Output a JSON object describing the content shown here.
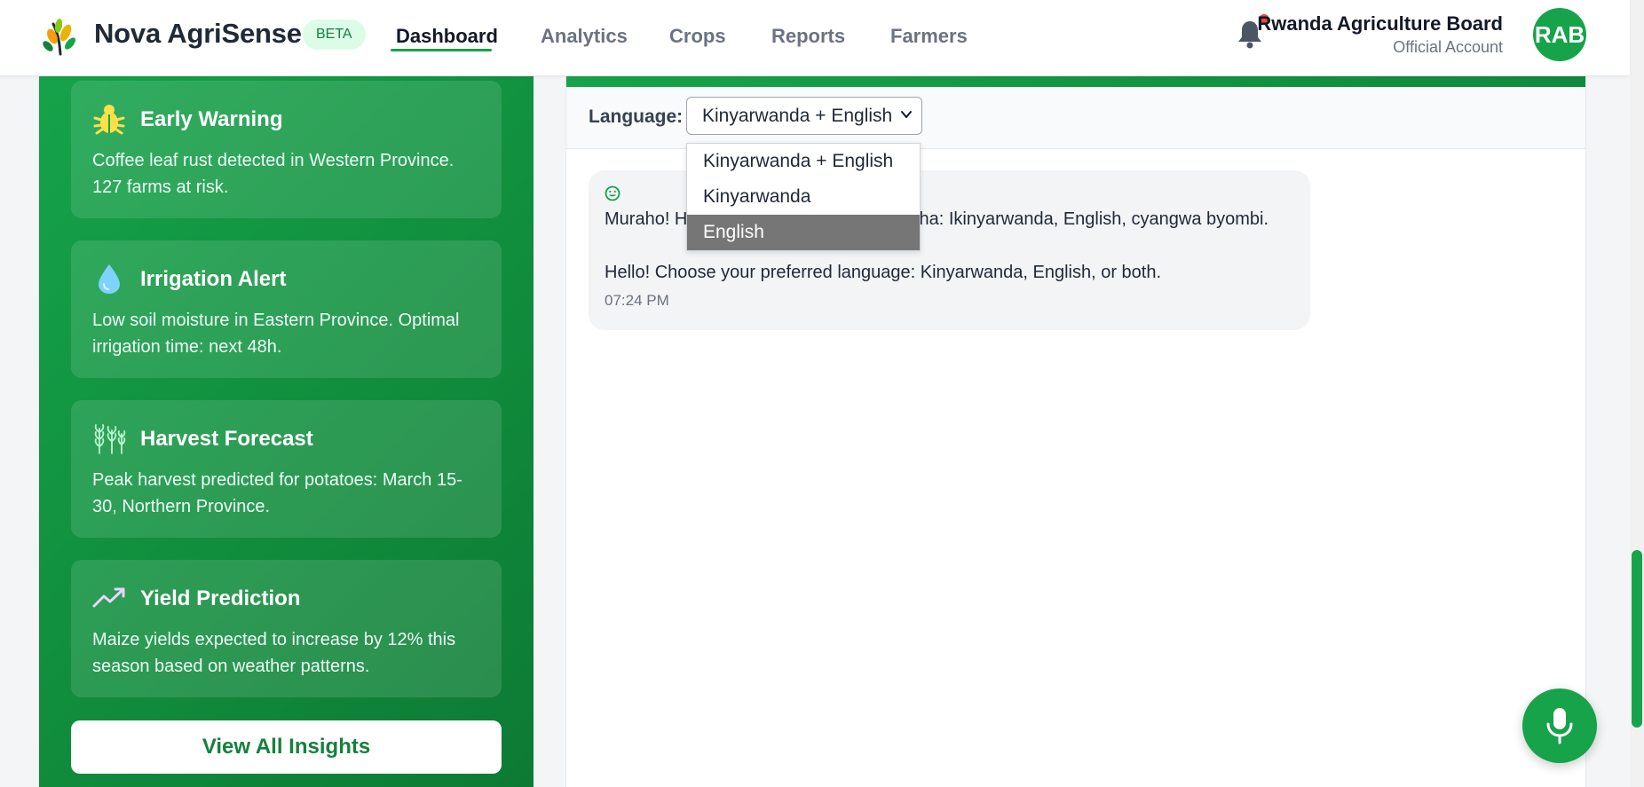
{
  "app": {
    "name": "Nova AgriSense",
    "badge": "BETA"
  },
  "nav": {
    "links": [
      "Dashboard",
      "Analytics",
      "Crops",
      "Reports",
      "Farmers"
    ],
    "active": "Dashboard"
  },
  "user": {
    "name": "Rwanda Agriculture Board",
    "role": "Official Account",
    "initials": "RAB"
  },
  "insights": {
    "cards": [
      {
        "icon": "bug-icon",
        "title": "Early Warning",
        "text": "Coffee leaf rust detected in Western Province. 127 farms at risk."
      },
      {
        "icon": "water-drop-icon",
        "title": "Irrigation Alert",
        "text": "Low soil moisture in Eastern Province. Optimal irrigation time: next 48h."
      },
      {
        "icon": "wheat-icon",
        "title": "Harvest Forecast",
        "text": "Peak harvest predicted for potatoes: March 15-30, Northern Province."
      },
      {
        "icon": "trend-up-icon",
        "title": "Yield Prediction",
        "text": "Maize yields expected to increase by 12% this season based on weather patterns."
      }
    ],
    "view_all_label": "View All Insights"
  },
  "chat": {
    "language_label": "Language:",
    "language_selected": "Kinyarwanda + English",
    "language_options": [
      "Kinyarwanda + English",
      "Kinyarwanda",
      "English"
    ],
    "highlighted_option": "English",
    "message": {
      "line1_visible_left": "Muraho! H",
      "line1_visible_right": "esha: Ikinyarwanda, English, cyangwa byombi.",
      "line2": "Hello! Choose your preferred language: Kinyarwanda, English, or both.",
      "time": "07:24 PM"
    }
  },
  "colors": {
    "brand_green": "#16a34a",
    "notification_dot": "#ef4444"
  }
}
